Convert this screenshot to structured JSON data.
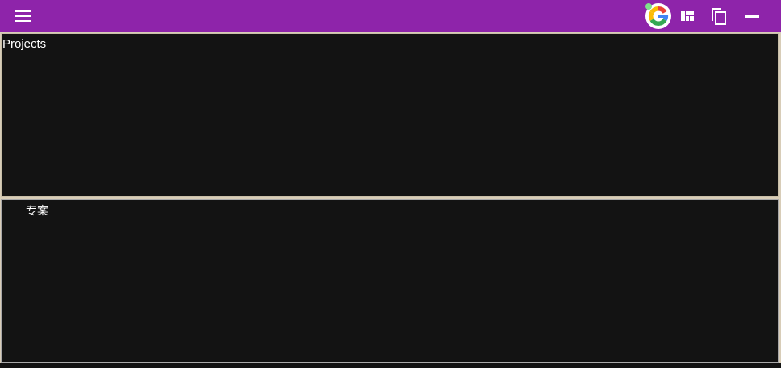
{
  "topbar": {
    "background": "#8e24aa",
    "menu_icon": "hamburger-menu-icon",
    "actions": [
      {
        "icon": "google-account-icon"
      },
      {
        "icon": "dashboard-layout-icon"
      },
      {
        "icon": "copy-icon"
      },
      {
        "icon": "minimize-icon"
      }
    ]
  },
  "panels": {
    "top": {
      "title": "Projects"
    },
    "bottom": {
      "title": "专案"
    }
  }
}
